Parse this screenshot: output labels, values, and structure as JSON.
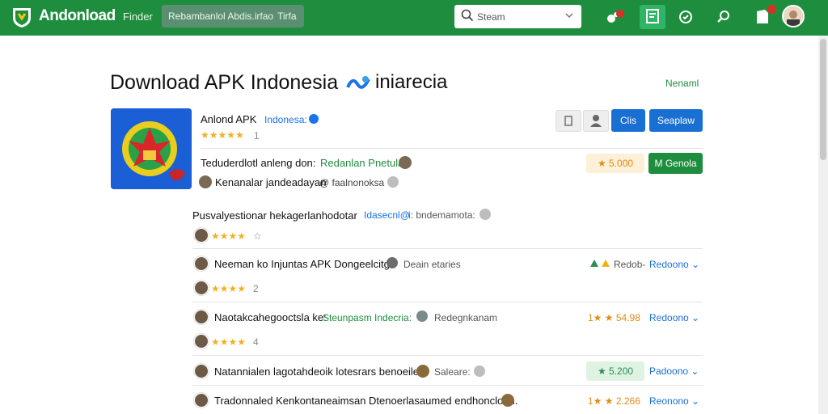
{
  "header": {
    "brand": "Andonload",
    "nav_link": "Finder",
    "nav_pill_label": "Rebambanlol Abdis.irfao",
    "nav_pill_tab": "Tirfa",
    "search_placeholder": "Steam",
    "colors": {
      "bar": "#1e8e3e",
      "accent_blue": "#1a6fd3",
      "badge": "#d93025"
    }
  },
  "page": {
    "title": "Download APK Indonesia",
    "title_suffix": "iniarecia",
    "top_link": "Nenaml"
  },
  "app": {
    "name": "Anlond APK",
    "developer": "Indonesa:",
    "rating_count": "1",
    "btn_primary": "Clis",
    "btn_secondary": "Seaplaw",
    "desc_line1": "Teduderdlotl anleng don:",
    "desc_line1_link": "Redanlan Pnetular:",
    "desc_line2": "Kenanalar jandeadayan",
    "desc_line2_tail": "@ faalnonoksa",
    "score_pill": "★ 5.000",
    "green_button": "M Genola"
  },
  "review_intro": {
    "text": "Pusvalyestionar hekagerlanhodotar",
    "link": "Idasecnl@",
    "muted": "i: bndemamota:",
    "rating_count": "☆"
  },
  "rows": [
    {
      "text": "Neeman ko Injuntas APK Dongeelcitg:",
      "muted": "Deain etaries",
      "score": "Redob-",
      "action": "Redoono ⌄",
      "rating": "2"
    },
    {
      "text": "Naotakcahegooctsla ke:",
      "link": "Steunpasm Indecria:",
      "muted": "Redegnkanam",
      "score": "1★ ★ 54.98",
      "action": "Redoono ⌄",
      "rating": "4"
    },
    {
      "text": "Natannialen lagotahdeoik lotesrars benoeilen:",
      "muted": "Saleare:",
      "score": "★ 5.200",
      "action": "Padoono ⌄"
    },
    {
      "text": "Tradonnaled Kenkontaneaimsan Dtenoerlasaumed endhoncloon.",
      "score": "1★ ★ 2.266",
      "action": "Reonono ⌄"
    }
  ]
}
